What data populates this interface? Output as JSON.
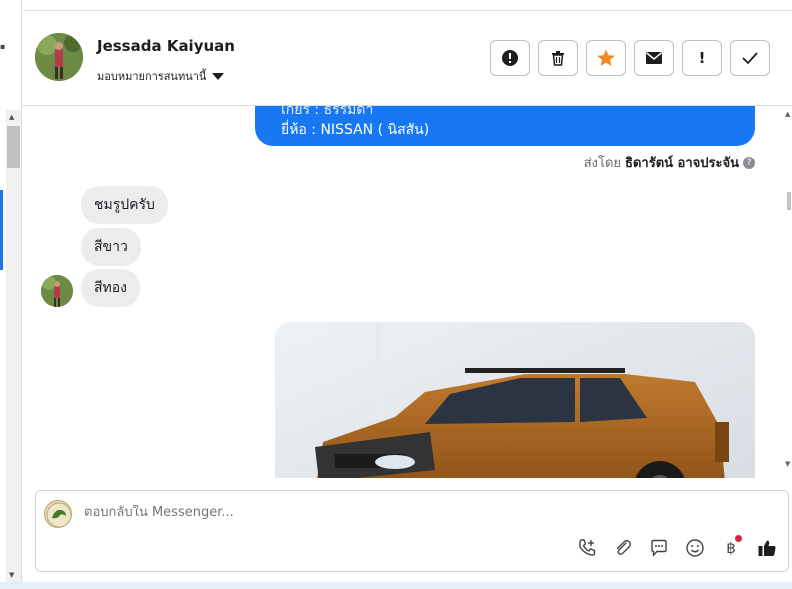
{
  "header": {
    "contact_name": "Jessada Kaiyuan",
    "assign_label": "มอบหมายการสนทนานี้"
  },
  "actions": {
    "spam": "!",
    "delete": "🗑",
    "star": "★",
    "mail": "✉",
    "important": "!",
    "done": "✓"
  },
  "messages": {
    "outgoing": {
      "line1": "เกียร์ : ธรรมดา",
      "line2": "ยี่ห้อ : NISSAN ( นิสสัน)",
      "sent_by_prefix": "ส่งโดย",
      "sent_by_name": "ธิดารัตน์ อาจประจัน"
    },
    "incoming": [
      {
        "text": "ชมรูปครับ"
      },
      {
        "text": "สีขาว"
      },
      {
        "text": "สีทอง"
      }
    ]
  },
  "composer": {
    "placeholder": "ตอบกลับใน Messenger..."
  },
  "colors": {
    "brand_blue": "#1877f2",
    "star_orange": "#f28c28",
    "notification_red": "#e41e3f"
  }
}
